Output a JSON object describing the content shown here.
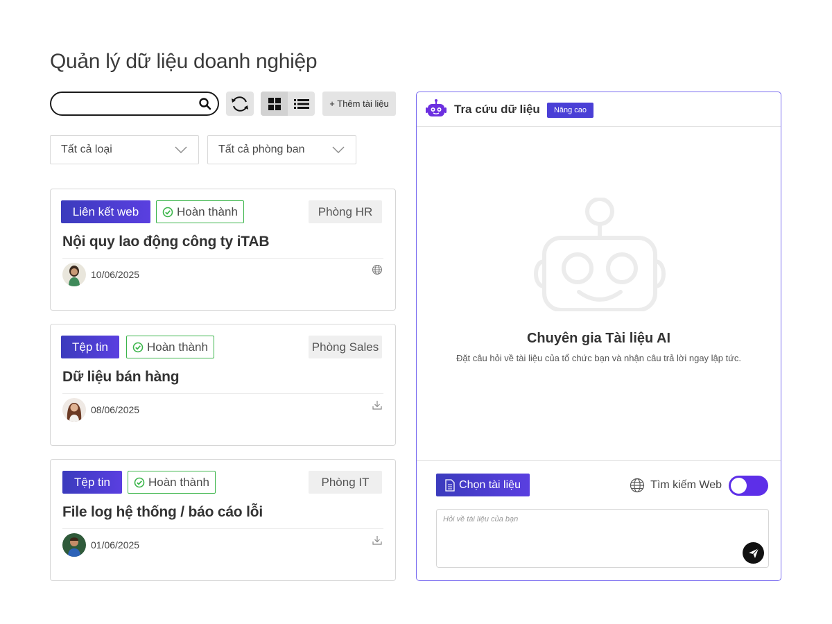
{
  "page": {
    "title": "Quản lý dữ liệu doanh nghiệp"
  },
  "toolbar": {
    "search_value": "",
    "add_label": "+ Thêm tài liệu"
  },
  "filters": {
    "type": "Tất cả loại",
    "department": "Tất cả phòng ban"
  },
  "documents": [
    {
      "type": "Liên kết web",
      "status": "Hoàn thành",
      "department": "Phòng HR",
      "title": "Nội quy lao động công ty iTAB",
      "date": "10/06/2025",
      "action_icon": "globe-icon"
    },
    {
      "type": "Tệp tin",
      "status": "Hoàn thành",
      "department": "Phòng Sales",
      "title": "Dữ liệu bán hàng",
      "date": "08/06/2025",
      "action_icon": "download-icon"
    },
    {
      "type": "Tệp tin",
      "status": "Hoàn thành",
      "department": "Phòng IT",
      "title": "File log hệ thống / báo cáo lỗi",
      "date": "01/06/2025",
      "action_icon": "download-icon"
    }
  ],
  "assistant": {
    "title": "Tra cứu dữ liệu",
    "badge": "Nâng cao",
    "empty_title": "Chuyên gia Tài liệu AI",
    "empty_subtitle": "Đặt câu hỏi về tài liệu của tổ chức bạn và nhận câu trả lời ngay lập tức.",
    "choose_label": "Chọn tài liệu",
    "web_search_label": "Tìm kiếm Web",
    "web_search_on": true,
    "input_placeholder": "Hỏi về tài liệu của bạn"
  },
  "colors": {
    "accent": "#4a3fd6",
    "toggle": "#5d2fe8",
    "status_green": "#3bb54a",
    "panel_border": "#7a6cf0"
  }
}
